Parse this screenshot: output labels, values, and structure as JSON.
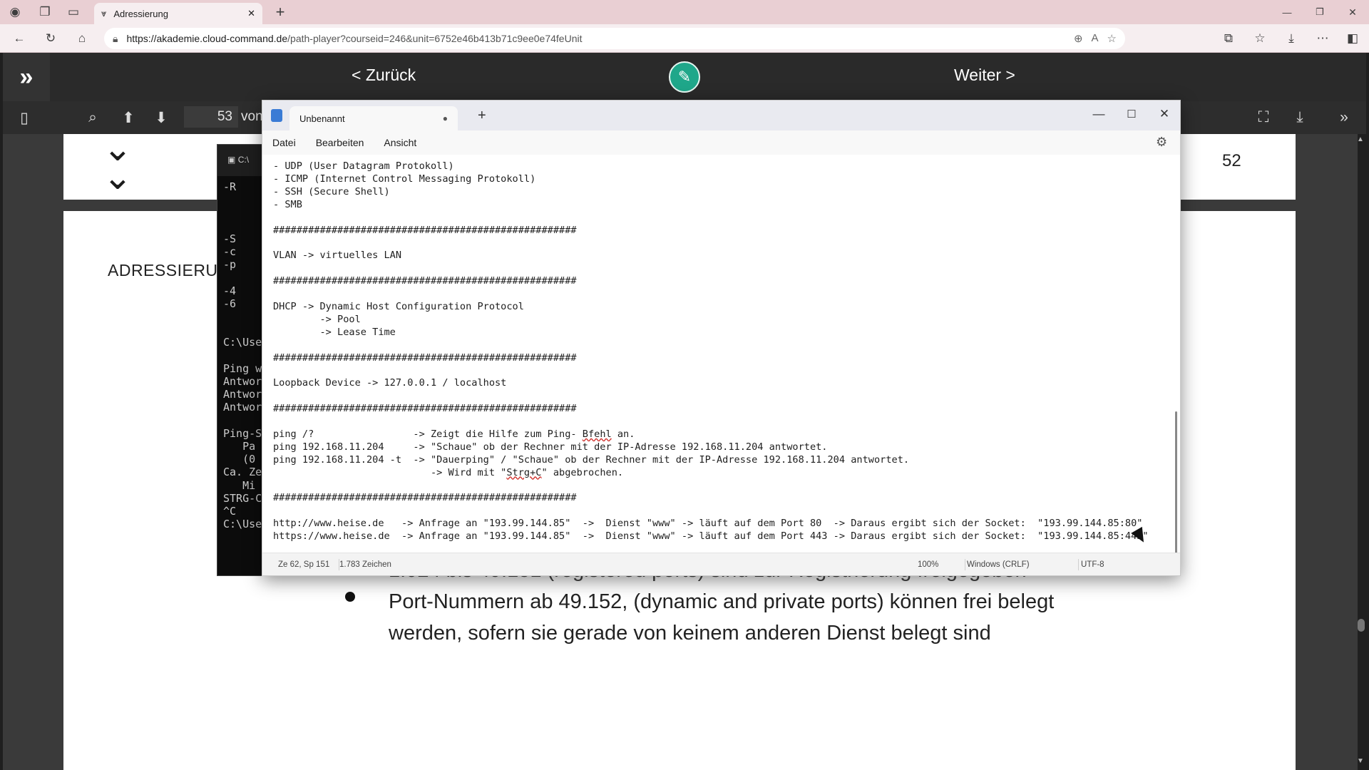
{
  "browser": {
    "tab": {
      "title": "Adressierung",
      "close": "✕"
    },
    "new_tab": "+",
    "url": {
      "host": "https://akademie.cloud-command.de",
      "path": "/path-player?courseid=246&unit=6752e46b413b71c9ee0e74feUnit"
    },
    "window_controls": {
      "minimize": "—",
      "restore": "❐",
      "close": "✕"
    }
  },
  "player": {
    "back_label": "< Zurück",
    "next_label": "Weiter >",
    "sidebar_toggle": "»",
    "edit_icon": "✎"
  },
  "pdf": {
    "current_page": "53",
    "of_label": "von",
    "prev_page_number": "52",
    "section_title": "ADRESSIERUN",
    "bullet_partial_line": "1.024 bis 49.151 (registered ports) sind zur Registrierung freigegeben",
    "bullet_line_1": "Port-Nummern ab 49.152, (dynamic and private ports) können frei belegt",
    "bullet_line_2": "werden, sofern sie gerade von keinem anderen Dienst belegt sind"
  },
  "cmd": {
    "title": "C:\\",
    "lines": [
      "-R",
      "",
      "",
      "",
      "-S",
      "-c",
      "-p",
      "",
      "-4",
      "-6",
      "",
      "",
      "C:\\Use",
      "",
      "Ping w",
      "Antwor",
      "Antwor",
      "Antwor",
      "",
      "Ping-S",
      "   Pa",
      "   (0",
      "Ca. Ze",
      "   Mi",
      "STRG-C",
      "^C",
      "C:\\Use"
    ]
  },
  "notepad": {
    "tab_title": "Unbenannt",
    "tab_modified": "●",
    "new_tab": "+",
    "menu": [
      "Datei",
      "Bearbeiten",
      "Ansicht"
    ],
    "lines": [
      "- UDP (User Datagram Protokoll)",
      "- ICMP (Internet Control Messaging Protokoll)",
      "- SSH (Secure Shell)",
      "- SMB",
      "",
      "####################################################",
      "",
      "VLAN -> virtuelles LAN",
      "",
      "####################################################",
      "",
      "DHCP -> Dynamic Host Configuration Protocol",
      "        -> Pool",
      "        -> Lease Time",
      "",
      "####################################################",
      "",
      "Loopback Device -> 127.0.0.1 / localhost",
      "",
      "####################################################",
      "",
      "ping /?                 -> Zeigt die Hilfe zum Ping- Bfehl an.",
      "ping 192.168.11.204     -> \"Schaue\" ob der Rechner mit der IP-Adresse 192.168.11.204 antwortet.",
      "ping 192.168.11.204 -t  -> \"Dauerping\" / \"Schaue\" ob der Rechner mit der IP-Adresse 192.168.11.204 antwortet.",
      "                           -> Wird mit \"Strg+C\" abgebrochen.",
      "",
      "####################################################",
      "",
      "http://www.heise.de   -> Anfrage an \"193.99.144.85\"  ->  Dienst \"www\" -> läuft auf dem Port 80  -> Daraus ergibt sich der Socket:  \"193.99.144.85:80\"",
      "https://www.heise.de  -> Anfrage an \"193.99.144.85\"  ->  Dienst \"www\" -> läuft auf dem Port 443 -> Daraus ergibt sich der Socket:  \"193.99.144.85:443\""
    ],
    "status": {
      "position": "Ze 62, Sp 151",
      "chars": "1.783 Zeichen",
      "zoom": "100%",
      "line_ending": "Windows (CRLF)",
      "encoding": "UTF-8"
    }
  }
}
